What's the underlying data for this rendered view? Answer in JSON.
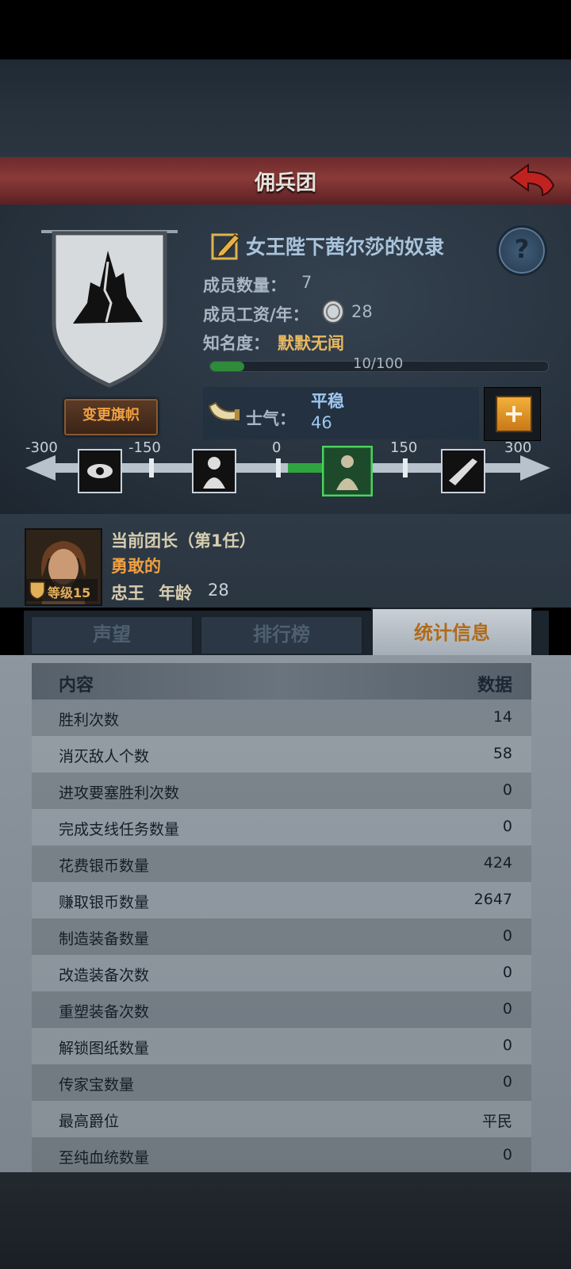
{
  "header": {
    "title": "佣兵团"
  },
  "guild": {
    "name": "女王陛下茜尔莎的奴隶",
    "members_label": "成员数量：",
    "members_value": "7",
    "wage_label": "成员工资/年：",
    "wage_value": "28",
    "fame_label": "知名度：",
    "fame_value": "默默无闻",
    "fame_progress_text": "10/100",
    "fame_progress": 0.1,
    "change_flag_label": "变更旗帜",
    "help_label": "?"
  },
  "morale": {
    "label": "士气：",
    "status": "平稳",
    "value": "46",
    "plus_label": "+",
    "scale_ticks": [
      "-300",
      "-150",
      "0",
      "150",
      "300"
    ],
    "scale_min": -300,
    "scale_max": 300,
    "current": 46
  },
  "leader": {
    "title": "当前团长（第1任）",
    "trait": "勇敢的",
    "loyalty": "忠王",
    "age_label": "年龄",
    "age": "28",
    "level_text": "等级15"
  },
  "tabs": [
    {
      "label": "声望",
      "active": false
    },
    {
      "label": "排行榜",
      "active": false
    },
    {
      "label": "统计信息",
      "active": true
    }
  ],
  "stats": {
    "col_content": "内容",
    "col_data": "数据",
    "rows": [
      {
        "k": "胜利次数",
        "v": "14"
      },
      {
        "k": "消灭敌人个数",
        "v": "58"
      },
      {
        "k": "进攻要塞胜利次数",
        "v": "0"
      },
      {
        "k": "完成支线任务数量",
        "v": "0"
      },
      {
        "k": "花费银币数量",
        "v": "424"
      },
      {
        "k": "赚取银币数量",
        "v": "2647"
      },
      {
        "k": "制造装备数量",
        "v": "0"
      },
      {
        "k": "改造装备次数",
        "v": "0"
      },
      {
        "k": "重塑装备次数",
        "v": "0"
      },
      {
        "k": "解锁图纸数量",
        "v": "0"
      },
      {
        "k": "传家宝数量",
        "v": "0"
      },
      {
        "k": "最高爵位",
        "v": "平民"
      },
      {
        "k": "至纯血统数量",
        "v": "0"
      }
    ]
  },
  "colors": {
    "title_bar": "#7a2e2e",
    "accent_orange": "#f0a040",
    "morale_blue": "#9ec6f0",
    "progress_green": "#2f8a3a"
  }
}
